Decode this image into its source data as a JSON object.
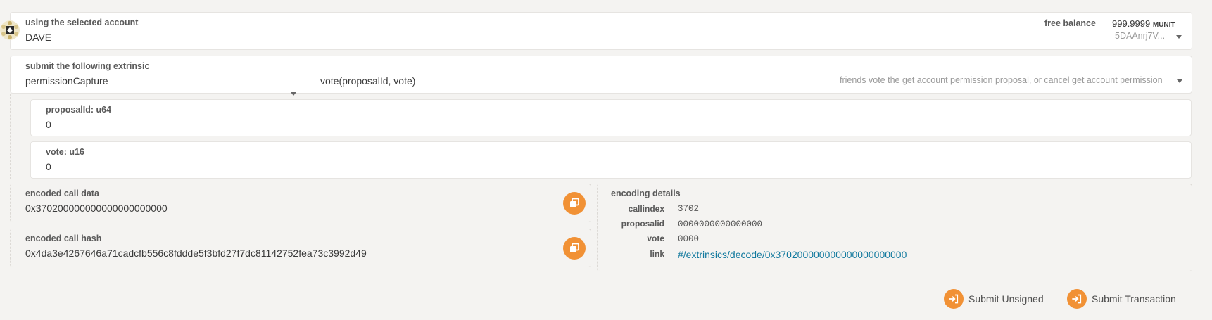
{
  "account": {
    "label": "using the selected account",
    "name": "DAVE",
    "balance_label": "free balance",
    "balance_value": "999.9999",
    "balance_unit": "MUNIT",
    "address": "5DAAnrj7V..."
  },
  "extrinsic": {
    "label": "submit the following extrinsic",
    "module": "permissionCapture",
    "method": "vote(proposalId, vote)",
    "description": "friends vote the get account permission proposal, or cancel get account permission"
  },
  "params": [
    {
      "label": "proposalId: u64",
      "value": "0"
    },
    {
      "label": "vote: u16",
      "value": "0"
    }
  ],
  "encoded_call_data": {
    "label": "encoded call data",
    "value": "0x370200000000000000000000"
  },
  "encoded_call_hash": {
    "label": "encoded call hash",
    "value": "0x4da3e4267646a71cadcfb556c8fddde5f3bfd27f7dc81142752fea73c3992d49"
  },
  "encoding_details": {
    "label": "encoding details",
    "rows": [
      {
        "key": "callindex",
        "value": "3702"
      },
      {
        "key": "proposalid",
        "value": "0000000000000000"
      },
      {
        "key": "vote",
        "value": "0000"
      },
      {
        "key": "link",
        "value": "#/extrinsics/decode/0x370200000000000000000000"
      }
    ]
  },
  "actions": {
    "submit_unsigned": "Submit Unsigned",
    "submit_transaction": "Submit Transaction"
  },
  "colors": {
    "accent": "#f19135",
    "link": "#11799e",
    "background": "#f4f3f1"
  }
}
